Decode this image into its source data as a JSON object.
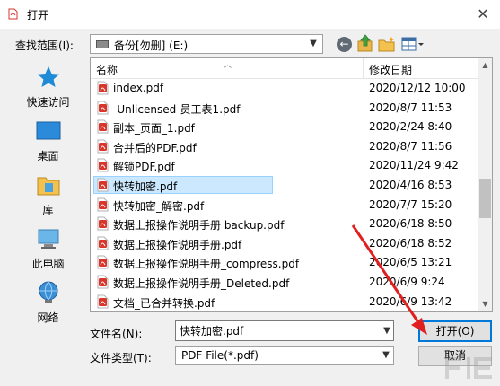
{
  "window": {
    "title": "打开",
    "close_glyph": "✕"
  },
  "toolbar": {
    "lookin_label": "查找范围(I):",
    "lookin_value": "备份[勿删] (E:)",
    "back_glyph": "←"
  },
  "places": [
    {
      "label": "快速访问",
      "icon": "star-icon"
    },
    {
      "label": "桌面",
      "icon": "desktop-icon"
    },
    {
      "label": "库",
      "icon": "library-icon"
    },
    {
      "label": "此电脑",
      "icon": "computer-icon"
    },
    {
      "label": "网络",
      "icon": "network-icon"
    }
  ],
  "filelist": {
    "columns": {
      "name": "名称",
      "date": "修改日期"
    },
    "files": [
      {
        "name": "index.pdf",
        "date": "2020/12/12 10:00"
      },
      {
        "name": "-Unlicensed-员工表1.pdf",
        "date": "2020/8/7 11:53"
      },
      {
        "name": "副本_页面_1.pdf",
        "date": "2020/2/24 8:40"
      },
      {
        "name": "合并后的PDF.pdf",
        "date": "2020/8/7 11:56"
      },
      {
        "name": "解锁PDF.pdf",
        "date": "2020/11/24 9:42"
      },
      {
        "name": "快转加密.pdf",
        "date": "2020/4/16 8:53",
        "selected": true
      },
      {
        "name": "快转加密_解密.pdf",
        "date": "2020/7/7 15:20"
      },
      {
        "name": "数据上报操作说明手册 backup.pdf",
        "date": "2020/6/18 8:50"
      },
      {
        "name": "数据上报操作说明手册.pdf",
        "date": "2020/6/18 8:52"
      },
      {
        "name": "数据上报操作说明手册_compress.pdf",
        "date": "2020/6/5 13:21"
      },
      {
        "name": "数据上报操作说明手册_Deleted.pdf",
        "date": "2020/6/9 9:24"
      },
      {
        "name": "文档_已合并转换.pdf",
        "date": "2020/6/9 13:42"
      }
    ]
  },
  "bottom": {
    "filename_label": "文件名(N):",
    "filename_value": "快转加密.pdf",
    "filetype_label": "文件类型(T):",
    "filetype_value": "PDF File(*.pdf)",
    "open_label": "打开(O)",
    "cancel_label": "取消"
  },
  "colors": {
    "selection": "#cce8ff",
    "accent": "#0078d7",
    "annotation": "#e02020",
    "pdf_red": "#d9352b"
  }
}
